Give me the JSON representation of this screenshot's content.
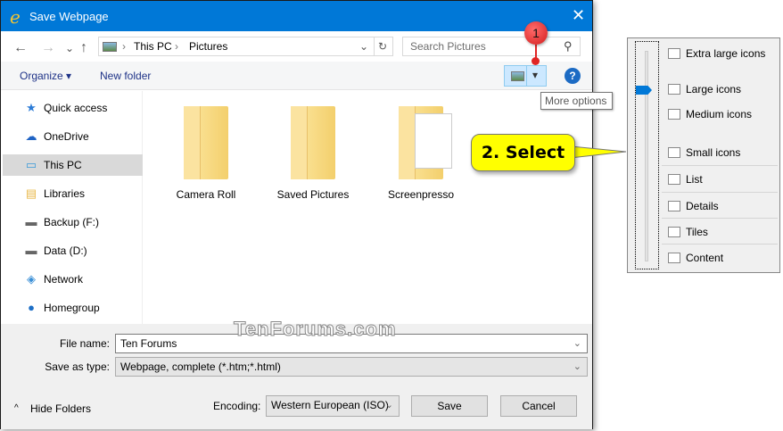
{
  "window": {
    "title": "Save Webpage",
    "close": "✕"
  },
  "nav": {
    "back": "←",
    "forward": "→",
    "recent": "⌄",
    "up": "↑",
    "breadcrumb": [
      "This PC",
      "Pictures"
    ],
    "sep": "›",
    "refresh": "↻",
    "search_placeholder": "Search Pictures",
    "search_icon": "⚲"
  },
  "toolbar": {
    "organize": "Organize ▾",
    "new_folder": "New folder",
    "help": "?",
    "more_options": "▾"
  },
  "tooltip": "More options",
  "sidebar": {
    "items": [
      {
        "label": "Quick access",
        "icon": "★",
        "color": "#2b7bd6"
      },
      {
        "label": "OneDrive",
        "icon": "☁",
        "color": "#1f63c4"
      },
      {
        "label": "This PC",
        "icon": "▭",
        "color": "#3a9ad9"
      },
      {
        "label": "Libraries",
        "icon": "▤",
        "color": "#e8b84a"
      },
      {
        "label": "Backup (F:)",
        "icon": "▬",
        "color": "#666"
      },
      {
        "label": "Data (D:)",
        "icon": "▬",
        "color": "#666"
      },
      {
        "label": "Network",
        "icon": "◈",
        "color": "#3a8fd6"
      },
      {
        "label": "Homegroup",
        "icon": "●",
        "color": "#1d6fc6"
      }
    ]
  },
  "folders": [
    "Camera Roll",
    "Saved Pictures",
    "Screenpresso"
  ],
  "form": {
    "file_name_label": "File name:",
    "file_name": "Ten Forums",
    "type_label": "Save as type:",
    "type": "Webpage, complete (*.htm;*.html)",
    "encoding_label": "Encoding:",
    "encoding": "Western European (ISO)",
    "save": "Save",
    "cancel": "Cancel",
    "hide_folders": "Hide Folders",
    "hide_icon": "^",
    "dd": "⌄"
  },
  "annotations": {
    "marker": "1",
    "callout": "2. Select",
    "watermark": "TenForums.com"
  },
  "view_menu": {
    "items": [
      "Extra large icons",
      "Large icons",
      "Medium icons",
      "Small icons",
      "List",
      "Details",
      "Tiles",
      "Content"
    ],
    "selected": "Large icons"
  }
}
